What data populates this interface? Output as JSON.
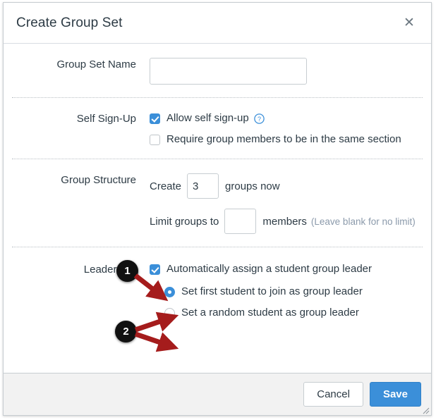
{
  "dialog": {
    "title": "Create Group Set",
    "close_icon": "close-icon",
    "close_glyph": "✕"
  },
  "form": {
    "group_set_name": {
      "label": "Group Set Name",
      "value": "",
      "placeholder": ""
    },
    "self_signup": {
      "label": "Self Sign-Up",
      "options": [
        {
          "label": "Allow self sign-up",
          "checked": true,
          "help_icon": "help-circle-icon",
          "help_glyph": "?"
        },
        {
          "label": "Require group members to be in the same section",
          "checked": false
        }
      ]
    },
    "group_structure": {
      "label": "Group Structure",
      "create_prefix": "Create",
      "groups_count": "3",
      "create_suffix": "groups now",
      "limit_prefix": "Limit groups to",
      "member_limit": "",
      "limit_suffix": "members",
      "limit_hint": "(Leave blank for no limit)"
    },
    "leadership": {
      "label": "Leadership",
      "auto_assign": {
        "label": "Automatically assign a student group leader",
        "checked": true
      },
      "radios": [
        {
          "label": "Set first student to join as group leader",
          "selected": true
        },
        {
          "label": "Set a random student as group leader",
          "selected": false
        }
      ]
    }
  },
  "footer": {
    "cancel_label": "Cancel",
    "save_label": "Save",
    "resize_icon": "resize-grip-icon"
  },
  "annotations": [
    {
      "number": "1",
      "target": "auto-assign-checkbox"
    },
    {
      "number": "2",
      "target": "leader-radio-group"
    }
  ],
  "colors": {
    "accent_blue": "#3b8fd9",
    "text": "#2d3b45",
    "hint": "#8b9aab",
    "border": "#c7cdd1",
    "footer_bg": "#f2f2f2",
    "annotation_arrow": "#a51c1c",
    "annotation_badge": "#111111"
  }
}
